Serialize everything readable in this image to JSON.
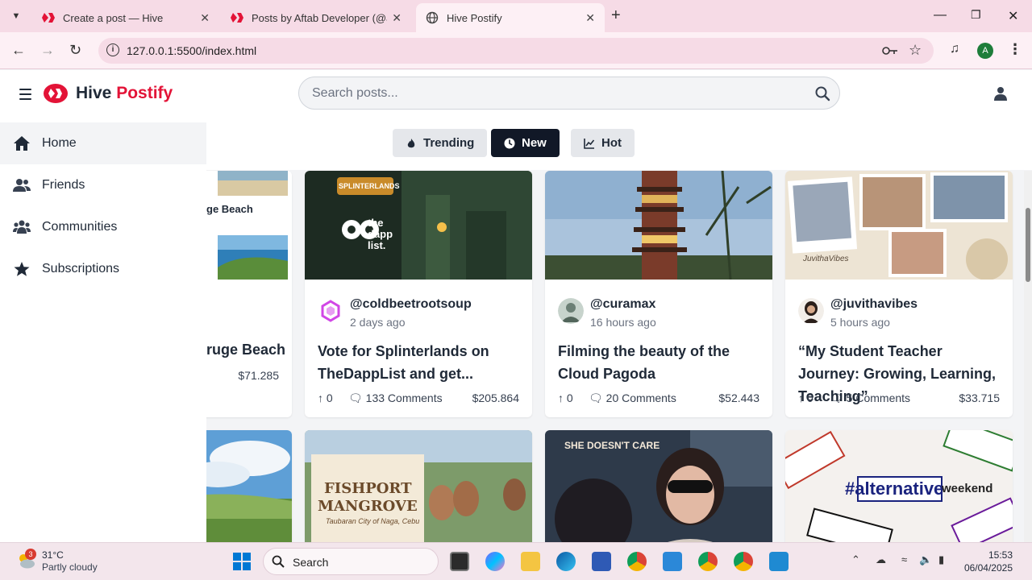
{
  "browser": {
    "tabs": [
      {
        "title": "Create a post — Hive"
      },
      {
        "title": "Posts by Aftab Developer (@aft"
      },
      {
        "title": "Hive Postify"
      }
    ],
    "new_tab": "+",
    "url": "127.0.0.1:5500/index.html",
    "profile_initial": "A"
  },
  "header": {
    "brand_main": "Hive",
    "brand_accent": "Postify",
    "search_placeholder": "Search posts..."
  },
  "sort": {
    "buttons": [
      {
        "label": "Trending",
        "icon": "fire-icon"
      },
      {
        "label": "New",
        "icon": "clock-icon"
      },
      {
        "label": "Hot",
        "icon": "chart-line-icon"
      }
    ],
    "active": "New"
  },
  "sidebar": {
    "items": [
      {
        "label": "Home",
        "icon": "home-icon"
      },
      {
        "label": "Friends",
        "icon": "friends-icon"
      },
      {
        "label": "Communities",
        "icon": "communities-icon"
      },
      {
        "label": "Subscriptions",
        "icon": "star-icon"
      }
    ]
  },
  "posts": {
    "partial": {
      "image_caption": "ge Beach",
      "title": "ruge Beach",
      "payout": "$71.285"
    },
    "cards": [
      {
        "author": "@coldbeetrootsoup",
        "time": "2 days ago",
        "title": "Vote for Splinterlands on TheDappList and get...",
        "votes": "0",
        "comments": "133 Comments",
        "payout": "$205.864",
        "thumb_text_1": "SPLINTERLANDS",
        "thumb_text_2": "the dapp list."
      },
      {
        "author": "@curamax",
        "time": "16 hours ago",
        "title": "Filming the beauty of the Cloud Pagoda",
        "votes": "0",
        "comments": "20 Comments",
        "payout": "$52.443"
      },
      {
        "author": "@juvithavibes",
        "time": "5 hours ago",
        "title": "“My Student Teacher Journey: Growing, Learning, Teaching”",
        "votes": "0",
        "comments": "5 Comments",
        "payout": "$33.715",
        "thumb_text_1": "JuvithaVibes"
      }
    ],
    "row2": [
      {
        "thumb_text_1": "FISHPORT",
        "thumb_text_2": "MANGROVE",
        "thumb_text_3": "Taubaran City of Naga, Cebu"
      },
      {
        "thumb_text_1": "SHE DOESN'T CARE"
      },
      {
        "thumb_text_1": "#alternative",
        "thumb_text_2": "weekend"
      }
    ]
  },
  "colors": {
    "brand": "#e31337",
    "active_button": "#111827",
    "chrome": "#f6dbe6"
  },
  "taskbar": {
    "weather_badge": "3",
    "temperature": "31°C",
    "condition": "Partly cloudy",
    "search_label": "Search",
    "time": "15:53",
    "date": "06/04/2025"
  }
}
